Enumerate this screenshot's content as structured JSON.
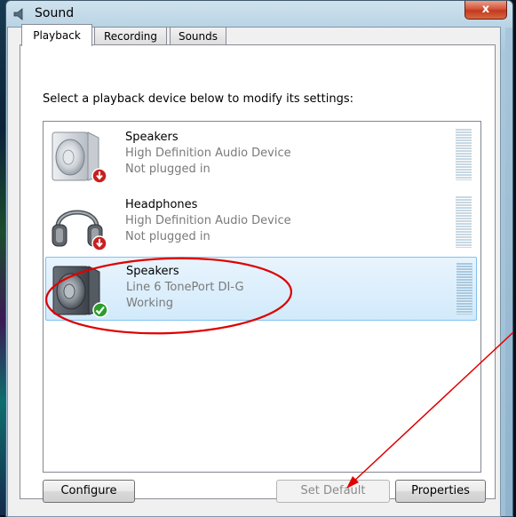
{
  "window": {
    "title": "Sound",
    "close_label": "x"
  },
  "tabs": [
    {
      "label": "Playback"
    },
    {
      "label": "Recording"
    },
    {
      "label": "Sounds"
    }
  ],
  "instruction": "Select a playback device below to modify its settings:",
  "devices": [
    {
      "name": "Speakers",
      "driver": "High Definition Audio Device",
      "status": "Not plugged in",
      "icon": "speaker-icon",
      "badge": "unplugged-badge-icon",
      "selected": false
    },
    {
      "name": "Headphones",
      "driver": "High Definition Audio Device",
      "status": "Not plugged in",
      "icon": "headphones-icon",
      "badge": "unplugged-badge-icon",
      "selected": false
    },
    {
      "name": "Speakers",
      "driver": "Line 6 TonePort DI-G",
      "status": "Working",
      "icon": "speaker-icon",
      "badge": "default-check-badge-icon",
      "selected": true
    }
  ],
  "buttons": {
    "configure": "Configure",
    "set_default": "Set Default",
    "properties": "Properties"
  },
  "colors": {
    "annotation_red": "#e00000",
    "selection": "#d2eafb",
    "check_green": "#2e9b2e",
    "unplugged_red": "#c82020"
  }
}
